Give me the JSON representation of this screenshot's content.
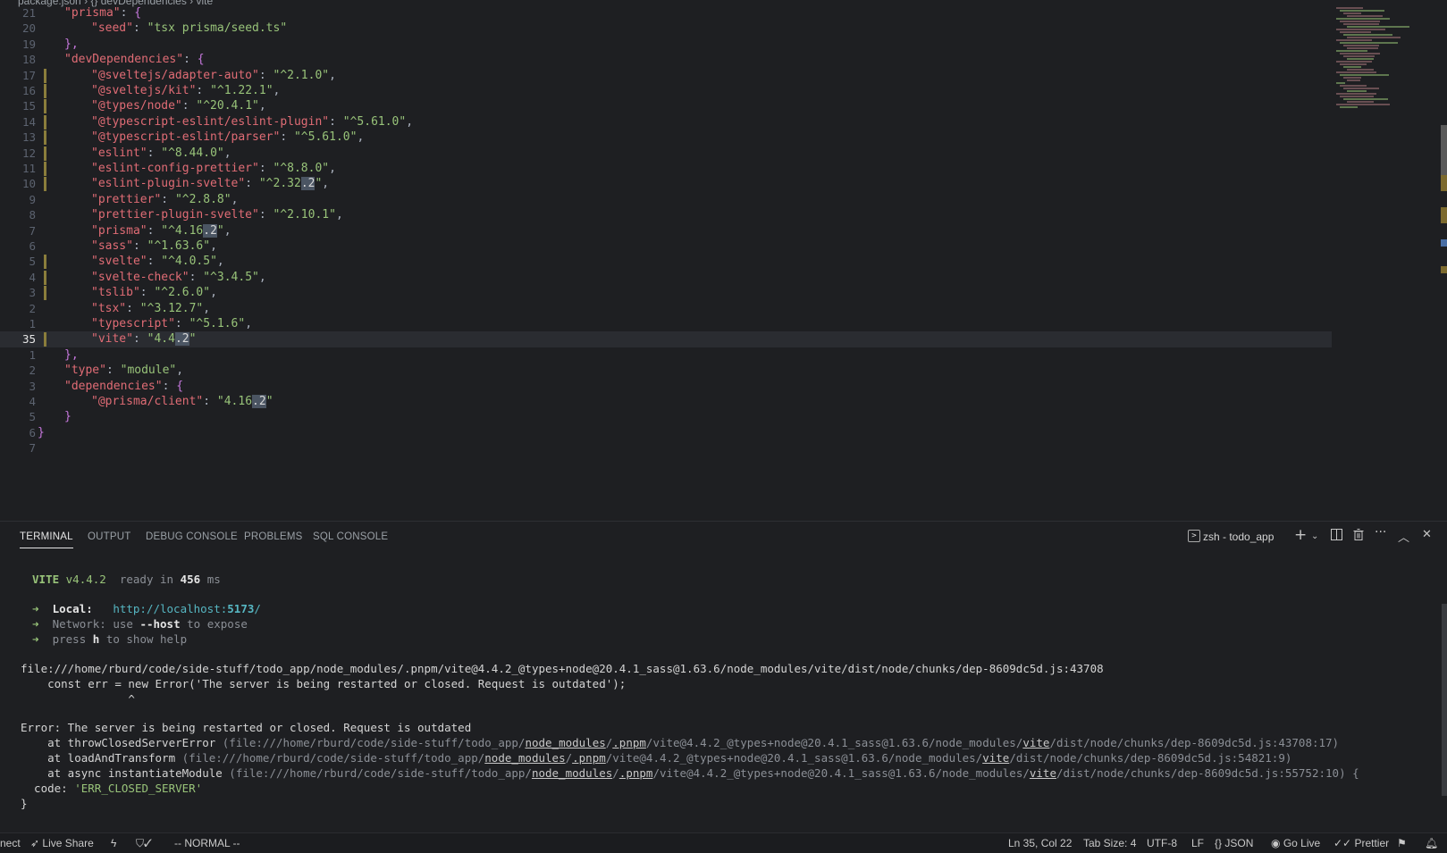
{
  "breadcrumb": {
    "items": [
      "package.json",
      "{} devDependencies",
      "vite"
    ]
  },
  "editor": {
    "lines": [
      {
        "ln": "21",
        "indent": 2,
        "key": "prisma",
        "open": "{"
      },
      {
        "ln": "20",
        "indent": 3,
        "key": "seed",
        "val": "tsx prisma/seed.ts"
      },
      {
        "ln": "19",
        "indent": 2,
        "close": "},"
      },
      {
        "ln": "18",
        "indent": 2,
        "key": "devDependencies",
        "open": "{"
      },
      {
        "ln": "17",
        "indent": 3,
        "key": "@sveltejs/adapter-auto",
        "val": "^2.1.0",
        "comma": true,
        "mod": true
      },
      {
        "ln": "16",
        "indent": 3,
        "key": "@sveltejs/kit",
        "val": "^1.22.1",
        "comma": true,
        "mod": true
      },
      {
        "ln": "15",
        "indent": 3,
        "key": "@types/node",
        "val": "^20.4.1",
        "comma": true,
        "mod": true
      },
      {
        "ln": "14",
        "indent": 3,
        "key": "@typescript-eslint/eslint-plugin",
        "val": "^5.61.0",
        "comma": true,
        "mod": true
      },
      {
        "ln": "13",
        "indent": 3,
        "key": "@typescript-eslint/parser",
        "val": "^5.61.0",
        "comma": true,
        "mod": true
      },
      {
        "ln": "12",
        "indent": 3,
        "key": "eslint",
        "val": "^8.44.0",
        "comma": true,
        "mod": true
      },
      {
        "ln": "11",
        "indent": 3,
        "key": "eslint-config-prettier",
        "val": "^8.8.0",
        "comma": true,
        "mod": true
      },
      {
        "ln": "10",
        "indent": 3,
        "key": "eslint-plugin-svelte",
        "val": "^2.32",
        "cur": ".2",
        "comma": true,
        "mod": true
      },
      {
        "ln": "9",
        "indent": 3,
        "key": "prettier",
        "val": "^2.8.8",
        "comma": true
      },
      {
        "ln": "8",
        "indent": 3,
        "key": "prettier-plugin-svelte",
        "val": "^2.10.1",
        "comma": true
      },
      {
        "ln": "7",
        "indent": 3,
        "key": "prisma",
        "val": "^4.16",
        "cur": ".2",
        "comma": true
      },
      {
        "ln": "6",
        "indent": 3,
        "key": "sass",
        "val": "^1.63.6",
        "comma": true
      },
      {
        "ln": "5",
        "indent": 3,
        "key": "svelte",
        "val": "^4.0.5",
        "comma": true,
        "mod": true
      },
      {
        "ln": "4",
        "indent": 3,
        "key": "svelte-check",
        "val": "^3.4.5",
        "comma": true,
        "mod": true
      },
      {
        "ln": "3",
        "indent": 3,
        "key": "tslib",
        "val": "^2.6.0",
        "comma": true,
        "mod": true
      },
      {
        "ln": "2",
        "indent": 3,
        "key": "tsx",
        "val": "^3.12.7",
        "comma": true
      },
      {
        "ln": "1",
        "indent": 3,
        "key": "typescript",
        "val": "^5.1.6",
        "comma": true
      },
      {
        "ln": "35",
        "indent": 3,
        "key": "vite",
        "val": "4.4",
        "cur": ".2",
        "current": true,
        "mod": true
      },
      {
        "ln": "1",
        "indent": 2,
        "close": "},"
      },
      {
        "ln": "2",
        "indent": 2,
        "key": "type",
        "val": "module",
        "comma": true
      },
      {
        "ln": "3",
        "indent": 2,
        "key": "dependencies",
        "open": "{"
      },
      {
        "ln": "4",
        "indent": 3,
        "key": "@prisma/client",
        "val": "4.16",
        "cur": ".2"
      },
      {
        "ln": "5",
        "indent": 2,
        "close": "}"
      },
      {
        "ln": "6",
        "indent": 1,
        "close": "}"
      },
      {
        "ln": "7",
        "indent": 0,
        "close": ""
      }
    ]
  },
  "panel": {
    "tabs": [
      "TERMINAL",
      "OUTPUT",
      "DEBUG CONSOLE",
      "PROBLEMS",
      "SQL CONSOLE"
    ],
    "active_tab": "TERMINAL",
    "terminal_name": "zsh - todo_app"
  },
  "terminal": {
    "vite_label": "VITE",
    "vite_version": "v4.4.2",
    "ready_text": "ready in",
    "ready_ms": "456",
    "ms": "ms",
    "arrow": "➜",
    "local_label": "Local:",
    "local_url_pre": "http://localhost:",
    "local_port": "5173",
    "local_url_post": "/",
    "network_label": "Network:",
    "network_pre": "use",
    "network_flag": "--host",
    "network_post": "to expose",
    "help_pre": "press",
    "help_key": "h",
    "help_post": "to show help",
    "file_line": "file:///home/rburd/code/side-stuff/todo_app/node_modules/.pnpm/vite@4.4.2_@types+node@20.4.1_sass@1.63.6/node_modules/vite/dist/node/chunks/dep-8609dc5d.js:43708",
    "code_line": "    const err = new Error('The server is being restarted or closed. Request is outdated');",
    "caret_line": "                ^",
    "error_line": "Error: The server is being restarted or closed. Request is outdated",
    "stack": [
      {
        "fn": "throwClosedServerError",
        "pre": "file:///home/rburd/code/side-stuff/todo_app/",
        "nm": "node_modules",
        "s1": "/",
        "pnpm": ".pnpm",
        "mid": "/vite@4.4.2_@types+node@20.4.1_sass@1.63.6/node_modules/",
        "vite": "vite",
        "post": "/dist/node/chunks/dep-8609dc5d.js:43708:17",
        "tail": ")"
      },
      {
        "fn": "loadAndTransform",
        "pre": "file:///home/rburd/code/side-stuff/todo_app/",
        "nm": "node_modules",
        "s1": "/",
        "pnpm": ".pnpm",
        "mid": "/vite@4.4.2_@types+node@20.4.1_sass@1.63.6/node_modules/",
        "vite": "vite",
        "post": "/dist/node/chunks/dep-8609dc5d.js:54821:9",
        "tail": ")"
      },
      {
        "fn": "async instantiateModule",
        "pre": "file:///home/rburd/code/side-stuff/todo_app/",
        "nm": "node_modules",
        "s1": "/",
        "pnpm": ".pnpm",
        "mid": "/vite@4.4.2_@types+node@20.4.1_sass@1.63.6/node_modules/",
        "vite": "vite",
        "post": "/dist/node/chunks/dep-8609dc5d.js:55752:10",
        "tail": ") {"
      }
    ],
    "code_key": "  code:",
    "code_val": "'ERR_CLOSED_SERVER'",
    "close_brace": "}"
  },
  "statusbar": {
    "remote": "nect",
    "live_share": "Live Share",
    "mode": "-- NORMAL --",
    "position": "Ln 35, Col 22",
    "tab_size": "Tab Size: 4",
    "encoding": "UTF-8",
    "eol": "LF",
    "language": "JSON",
    "go_live": "Go Live",
    "prettier": "Prettier"
  },
  "colors": {
    "accent": "#98c379",
    "key": "#e06c75",
    "bracket": "#c678dd",
    "link": "#56b6c2"
  }
}
